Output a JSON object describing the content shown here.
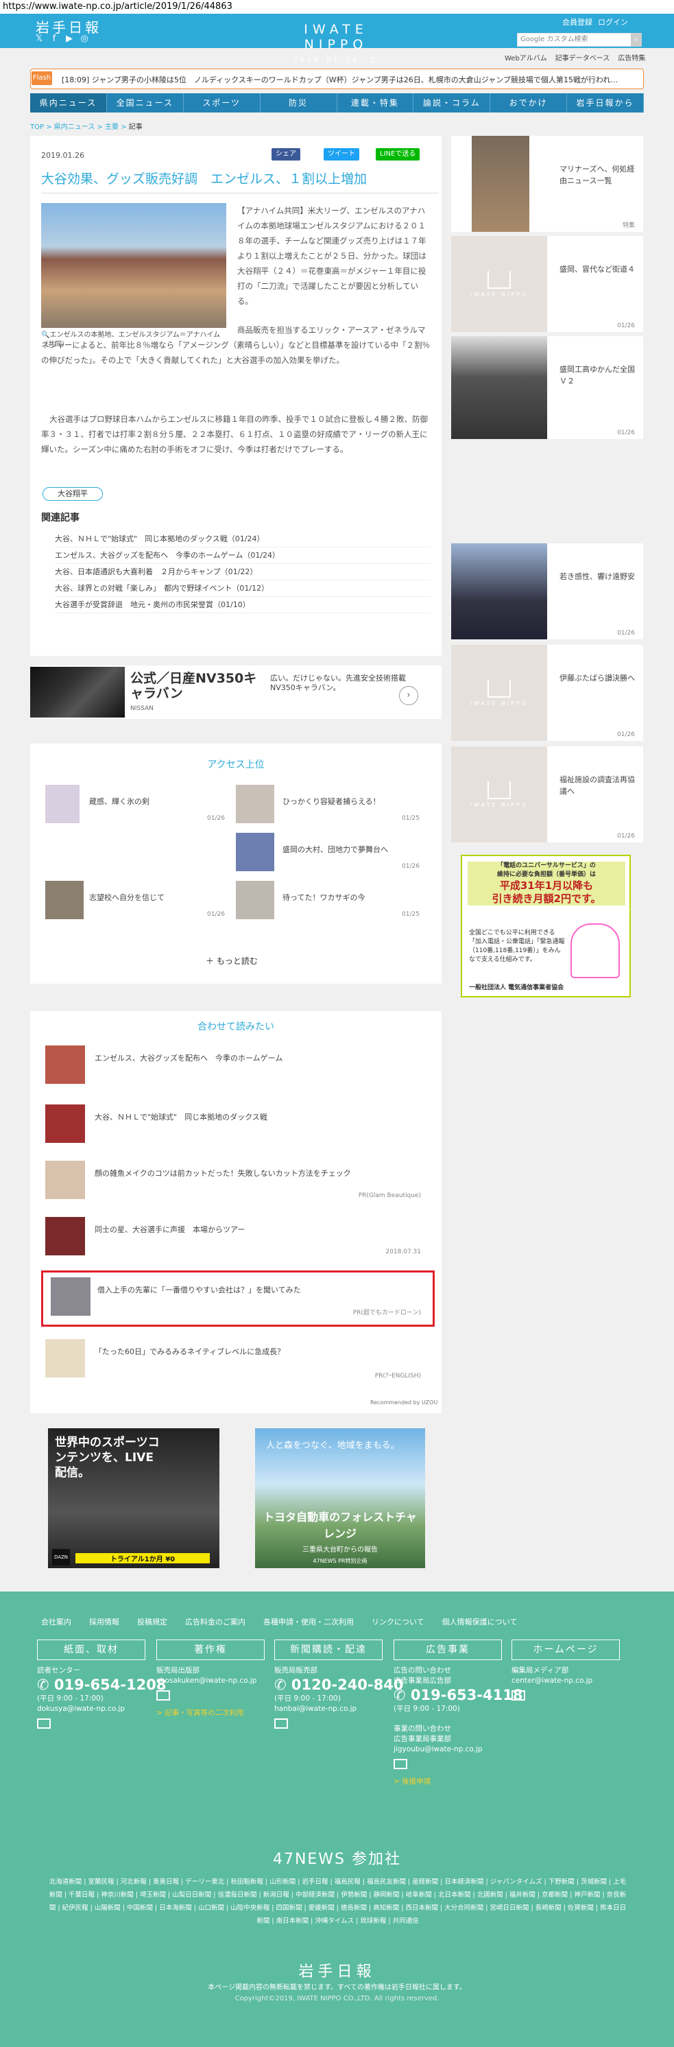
{
  "url": "https://www.iwate-np.co.jp/article/2019/1/26/44863",
  "header": {
    "logo": "岩手日報",
    "brand": "IWATE NIPPO",
    "date": "2019.01.26. 土",
    "member": "会員登録",
    "login": "ログイン",
    "search_placeholder": "Google カスタム検索",
    "subnav": [
      "Webアルバム",
      "記事データベース",
      "広告特集"
    ]
  },
  "flash": {
    "label": "Flash",
    "text": "[18:09] ジャンプ男子の小林陵は5位　ノルディックスキーのワールドカップ（W杯）ジャンプ男子は26日、札幌市の大倉山ジャンプ競技場で個人第15戦が行われ…"
  },
  "gnav": [
    "県内ニュース",
    "全国ニュース",
    "スポーツ",
    "防災",
    "連載・特集",
    "論説・コラム",
    "おでかけ",
    "岩手日報から"
  ],
  "breadcrumb": [
    "TOP",
    "県内ニュース",
    "主要",
    "記事"
  ],
  "article": {
    "date": "2019.01.26",
    "share": [
      "シェア",
      "ツイート",
      "LINEで送る"
    ],
    "title": "大谷効果、グッズ販売好調　エンゼルス、１割以上増加",
    "caption": "エンゼルスの本拠地、エンゼルスタジアム＝アナハイム（共同）",
    "p1": "【アナハイム共同】米大リーグ、エンゼルスのアナハイムの本拠地球場エンゼルスタジアムにおける２０１８年の選手、チームなど関連グッズ売り上げは１７年より１割以上増えたことが２５日、分かった。球団は大谷翔平（２４）＝花巻東高＝がメジャー１年目に投打の「二刀流」で活躍したことが要因と分析している。",
    "p2": "商品販売を担当するエリック・アースア・ゼネラルマネジャーによると、前年比８％増なら「アメージング（素晴らしい）」などと目標基準を設けている中「２割％の伸びだった」。その上で「大きく貢献してくれた」と大谷選手の加入効果を挙げた。",
    "p3": "大谷選手はプロ野球日本ハムからエンゼルスに移籍１年目の昨季、投手で１０試合に登板し４勝２敗、防御率３・３１、打者では打率２割８分５厘、２２本塁打、６１打点、１０盗塁の好成績でア・リーグの新人王に輝いた。シーズン中に痛めた右肘の手術をオフに受け、今季は打者だけでプレーする。",
    "tag": "大谷翔平",
    "related_heading": "関連記事",
    "related": [
      "大谷、ＮＨＬで\"始球式\"　同じ本拠地のダックス戦（01/24）",
      "エンゼルス、大谷グッズを配布へ　今季のホームゲーム（01/24）",
      "大谷、日本語通訳も大喜利着　２月からキャンプ（01/22）",
      "大谷、球界との対戦「楽しみ」　都内で野球イベント（01/12）",
      "大谷選手が受賞辞退　地元・奥州の市民栄誉賞（01/10）"
    ]
  },
  "ad": {
    "title": "公式／日産NV350キャラバン",
    "sub": "NISSAN",
    "desc": "広い。だけじゃない。先進安全技術搭載NV350キャラバン。",
    "arrow": "›"
  },
  "ranking": {
    "title": "アクセス上位",
    "items": [
      {
        "text": "蔵感、輝く氷の剣",
        "date": "01/26"
      },
      {
        "text": "ひっかくり容疑者捕らえる！",
        "date": "01/25"
      },
      {
        "text": "盛岡の大村、団地力で夢舞台へ",
        "date": "01/26"
      },
      {
        "text": "志望校へ自分を信じて",
        "date": "01/26"
      },
      {
        "text": "待ってた！ワカサギの今",
        "date": "01/25"
      }
    ],
    "more": "もっと読む"
  },
  "related": {
    "title": "合わせて読みたい",
    "items": [
      {
        "text": "エンゼルス、大谷グッズを配布へ　今季のホームゲーム",
        "sponsor": ""
      },
      {
        "text": "大谷、ＮＨＬで\"始球式\"　同じ本拠地のダックス戦",
        "sponsor": ""
      },
      {
        "text": "顔の雑魚メイクのコツは前カットだった！失敗しないカット方法をチェック",
        "sponsor": "PR(Glam Beautique)"
      },
      {
        "text": "同士の星、大谷選手に声援　本場からツアー",
        "sponsor": "2018.07.31"
      },
      {
        "text": "借入上手の先輩に「一番借りやすい会社は？」を聞いてみた",
        "sponsor": "PR(超でもカードローン)"
      },
      {
        "text": "「たった60日」でみるみるネイティブレベルに急成長？",
        "sponsor": "PR(ｱｰENGLISH)"
      }
    ],
    "recommended": "Recommended by UZOU"
  },
  "sidebar": [
    {
      "text": "マリナーズへ、何処経由ニュース一覧",
      "date": "特集"
    },
    {
      "text": "盛岡、冒代など街道４",
      "date": "01/26"
    },
    {
      "text": "盛岡工高ゆかんだ全国Ｖ２",
      "date": "01/26"
    },
    {
      "text": "若き感性、響け遠野安",
      "date": "01/26"
    },
    {
      "text": "伊藤ぶたばら讃決勝へ",
      "date": "01/26"
    },
    {
      "text": "福祉施設の調査法再協議へ",
      "date": "01/26"
    }
  ],
  "side_ad": {
    "l1": "「電話のユニバーサルサービス」の",
    "l2": "維持に必要な負担額（番号単価）は",
    "l3": "平成31年1月以降も",
    "l4": "引き続き月額2円です。",
    "l5": "全国どこでも公平に利用できる「加入電話・公衆電話」「緊急通報（110番,118番,119番）」をみんなで支える仕組みです。",
    "l6": "一般社団法人 電気通信事業者協会"
  },
  "bottom_ads": {
    "a1_title": "世界中のスポーツコンテンツを、LIVE配信。",
    "a1_sub": "トライアル1か月 ¥0",
    "a1_logo": "DAZN",
    "a2_title": "人と森をつなぐ、地域をまもる。",
    "a2_main": "トヨタ自動車のフォレストチャレンジ",
    "a2_sub": "三重県大台町からの報告",
    "a2_foot": "47NEWS PR特別企画"
  },
  "footer": {
    "nav": [
      "会社案内",
      "採用情報",
      "投稿規定",
      "広告料金のご案内",
      "各種申請・使用・二次利用",
      "リンクについて",
      "個人情報保護について"
    ],
    "boxes": [
      "紙面、取材",
      "著作権",
      "新聞購読・配達",
      "広告事業",
      "ホームページ"
    ],
    "col1": {
      "label": "読者センター",
      "tel": "019-654-1208",
      "hours": "(平日 9:00 - 17:00)",
      "mail": "dokusya@iwate-np.co.jp"
    },
    "col2": {
      "label": "販売局出版部",
      "mail": "chosakuken@iwate-np.co.jp",
      "link": "> 記事・写真等の二次利用"
    },
    "col3": {
      "label": "販売局販売部",
      "tel": "0120-240-840",
      "hours": "(平日 9:00 - 17:00)",
      "mail": "hanbai@iwate-np.co.jp"
    },
    "col4": {
      "label1": "広告の問い合わせ",
      "label2": "広告事業局広告部",
      "tel": "019-653-4118",
      "hours": "(平日 9:00 - 17:00)",
      "label3": "事業の問い合わせ",
      "label4": "広告事業局事業部",
      "mail": "jigyoubu@iwate-np.co.jp",
      "link": "> 後援申請"
    },
    "col5": {
      "label": "編集局メディア部",
      "mail": "center@iwate-np.co.jp"
    },
    "news_title": "47NEWS 参加社",
    "news_links": "北海道新聞 | 室蘭民報 | 河北新報 | 東奥日報 | デーリー東北 | 秋田魁新報 | 山形新聞 | 岩手日報 | 福島民報 | 福島民友新聞 | 産経新聞 | 日本経済新聞 | ジャパンタイムズ | 下野新聞 | 茨城新聞 | 上毛新聞 | 千葉日報 | 神奈川新聞 | 埼玉新聞 | 山梨日日新聞 | 信濃毎日新聞 | 新潟日報 | 中部経済新聞 | 伊勢新聞 | 静岡新聞 | 岐阜新聞 | 北日本新聞 | 北國新聞 | 福井新聞 | 京都新聞 | 神戸新聞 | 奈良新聞 | 紀伊民報 | 山陽新聞 | 中国新聞 | 日本海新聞 | 山口新聞 | 山陰中央新報 | 四国新聞 | 愛媛新聞 | 徳島新聞 | 高知新聞 | 西日本新聞 | 大分合同新聞 | 宮崎日日新聞 | 長崎新聞 | 佐賀新聞 | 熊本日日新聞 | 南日本新聞 | 沖縄タイムス | 琉球新報 | 共同通信",
    "logo": "岩手日報",
    "notice": "本ページ掲載内容の無断転載を禁じます。すべての著作権は岩手日報社に属します。",
    "copyright": "Copyright©2019, IWATE NIPPO CO.,LTD. All rights reserved."
  }
}
